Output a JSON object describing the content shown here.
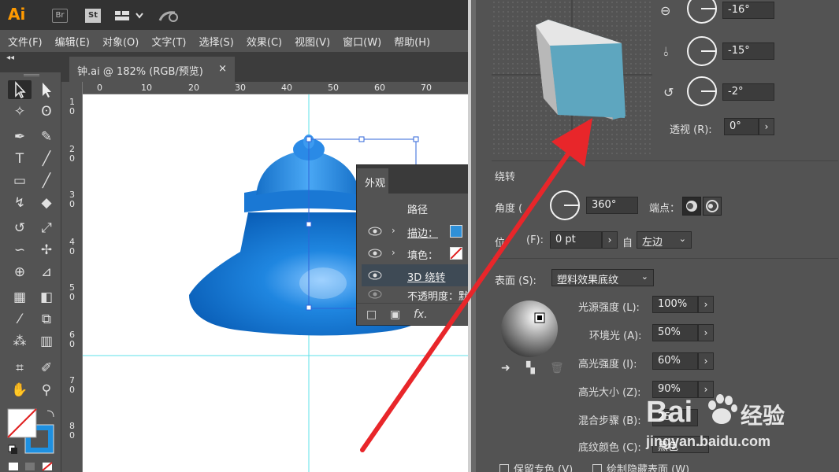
{
  "app": {
    "logo": "Ai",
    "bridge": "Br",
    "stock": "St"
  },
  "menu": [
    "文件(F)",
    "编辑(E)",
    "对象(O)",
    "文字(T)",
    "选择(S)",
    "效果(C)",
    "视图(V)",
    "窗口(W)",
    "帮助(H)"
  ],
  "document_tab": {
    "title": "钟.ai @ 182% (RGB/预览)",
    "close": "×"
  },
  "panel_collapse": "◂◂",
  "ruler": {
    "h_labels": [
      "0",
      "10",
      "20",
      "30",
      "40",
      "50",
      "60",
      "70"
    ],
    "v_labels": [
      "1\n0",
      "2\n0",
      "3\n0",
      "4\n0",
      "5\n0",
      "6\n0",
      "7\n0",
      "8\n0"
    ]
  },
  "appearance_panel": {
    "tab": "外观",
    "header": "路径",
    "rows": [
      {
        "label": "描边：",
        "swatch": "#2f90d8"
      },
      {
        "label": "填色：",
        "swatch": "none"
      },
      {
        "label": "3D 绕转"
      },
      {
        "label": "不透明度：默"
      }
    ],
    "fx": "fx."
  },
  "dialog": {
    "rotation": {
      "x": "-16°",
      "y": "-15°",
      "z": "-2°",
      "perspective_label": "透视 (R):",
      "perspective_value": "0°"
    },
    "revolve": {
      "section_title": "绕转",
      "angle_label": "角度 (",
      "angle_value": "360°",
      "cap_label": "端点：",
      "offset_label": "位",
      "offset_label2": "(F):",
      "offset_value": "0 pt",
      "from_label": "自",
      "from_value": "左边"
    },
    "surface": {
      "label": "表面 (S):",
      "value": "塑料效果底纹",
      "light_intensity_label": "光源强度 (L):",
      "light_intensity": "100%",
      "ambient_label": "环境光 (A):",
      "ambient": "50%",
      "highlight_intensity_label": "高光强度 (I):",
      "highlight_intensity": "60%",
      "highlight_size_label": "高光大小 (Z):",
      "highlight_size": "90%",
      "blend_steps_label": "混合步骤 (B):",
      "blend_steps": "25",
      "shading_color_label": "底纹颜色 (C):",
      "shading_color": "黑色"
    },
    "checkboxes": {
      "preserve_spot": "保留专色 (V)",
      "draw_hidden": "绘制隐藏表面 (W)"
    }
  },
  "watermark": {
    "brand": "Bai",
    "brand2": "经验",
    "url": "jingyan.baidu.com"
  },
  "colors": {
    "bell_blue": "#1f7fd6",
    "arrow_red": "#e8262a",
    "cube_front": "#5ea6bf"
  }
}
